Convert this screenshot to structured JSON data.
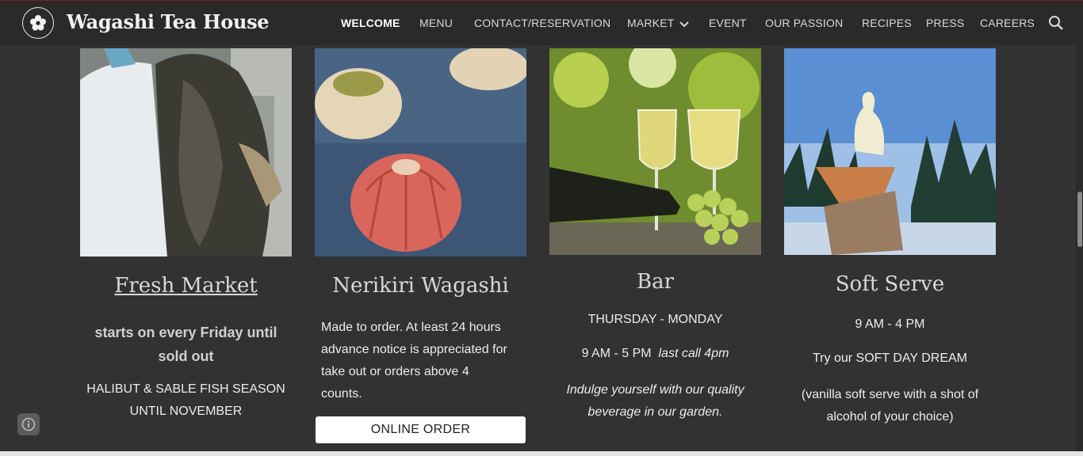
{
  "header": {
    "site_title": "Wagashi Tea House",
    "logo_text": "WAGASHI",
    "nav": [
      {
        "label": "WELCOME",
        "active": true
      },
      {
        "label": "MENU"
      },
      {
        "label": "CONTACT/RESERVATION"
      },
      {
        "label": "MARKET",
        "has_dropdown": true
      },
      {
        "label": "EVENT"
      },
      {
        "label": "OUR PASSION"
      },
      {
        "label": "RECIPES"
      },
      {
        "label": "PRESS"
      },
      {
        "label": "CAREERS"
      }
    ],
    "search_icon": "search-icon"
  },
  "cards": {
    "fresh_market": {
      "title": "Fresh Market",
      "line1": "starts on every Friday until",
      "line2": "sold out",
      "line3": "HALIBUT & SABLE FISH SEASON",
      "line4": "UNTIL NOVEMBER"
    },
    "nerikiri": {
      "title": "Nerikiri Wagashi",
      "line1": "Made to order. At least 24 hours",
      "line2": "advance notice is appreciated for",
      "line3": "take out or orders above 4",
      "line4": "counts.",
      "button": "ONLINE ORDER"
    },
    "bar": {
      "title": "Bar",
      "days": "THURSDAY - MONDAY",
      "hours": "9 AM - 5 PM",
      "last_call": "last call 4pm",
      "line1": "Indulge yourself with our quality",
      "line2": "beverage in our garden."
    },
    "soft_serve": {
      "title": "Soft Serve",
      "hours": "9 AM - 4 PM",
      "promo": "Try our SOFT DAY DREAM",
      "line1": "(vanilla soft serve with a shot of",
      "line2": "alcohol of your choice)"
    }
  },
  "colors": {
    "background": "#323232",
    "header": "#2a2a2a",
    "text": "#ececec"
  }
}
